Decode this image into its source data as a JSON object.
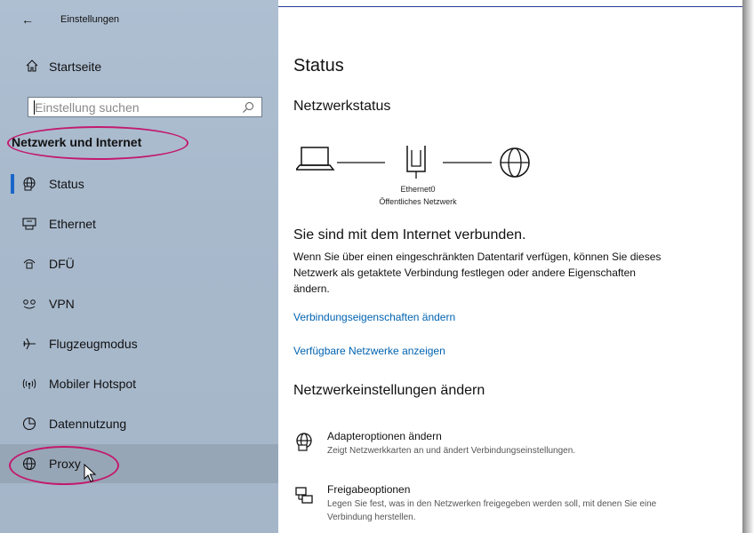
{
  "window": {
    "title": "Einstellungen"
  },
  "sidebar": {
    "home_label": "Startseite",
    "search_placeholder": "Einstellung suchen",
    "section_title": "Netzwerk und Internet",
    "items": [
      {
        "label": "Status",
        "icon": "globe-status-icon",
        "active": true
      },
      {
        "label": "Ethernet",
        "icon": "ethernet-icon"
      },
      {
        "label": "DFÜ",
        "icon": "dialup-icon"
      },
      {
        "label": "VPN",
        "icon": "vpn-icon"
      },
      {
        "label": "Flugzeugmodus",
        "icon": "airplane-icon"
      },
      {
        "label": "Mobiler Hotspot",
        "icon": "hotspot-icon"
      },
      {
        "label": "Datennutzung",
        "icon": "data-usage-icon"
      },
      {
        "label": "Proxy",
        "icon": "globe-icon",
        "hover": true
      }
    ]
  },
  "main": {
    "title": "Status",
    "network_status_heading": "Netzwerkstatus",
    "adapter_name": "Ethernet0",
    "network_type": "Öffentliches Netzwerk",
    "connected_text": "Sie sind mit dem Internet verbunden.",
    "description": "Wenn Sie über einen eingeschränkten Datentarif verfügen, können Sie dieses Netzwerk als getaktete Verbindung festlegen oder andere Eigenschaften ändern.",
    "link_properties": "Verbindungseigenschaften ändern",
    "link_networks": "Verfügbare Netzwerke anzeigen",
    "change_settings_heading": "Netzwerkeinstellungen ändern",
    "options": [
      {
        "title": "Adapteroptionen ändern",
        "subtitle": "Zeigt Netzwerkkarten an und ändert Verbindungseinstellungen.",
        "icon": "adapter-icon"
      },
      {
        "title": "Freigabeoptionen",
        "subtitle": "Legen Sie fest, was in den Netzwerken freigegeben werden soll, mit denen Sie eine Verbindung herstellen.",
        "icon": "sharing-icon"
      }
    ]
  },
  "colors": {
    "accent": "#1a66c8",
    "link": "#0063b1",
    "annotation": "#c21a6e"
  }
}
